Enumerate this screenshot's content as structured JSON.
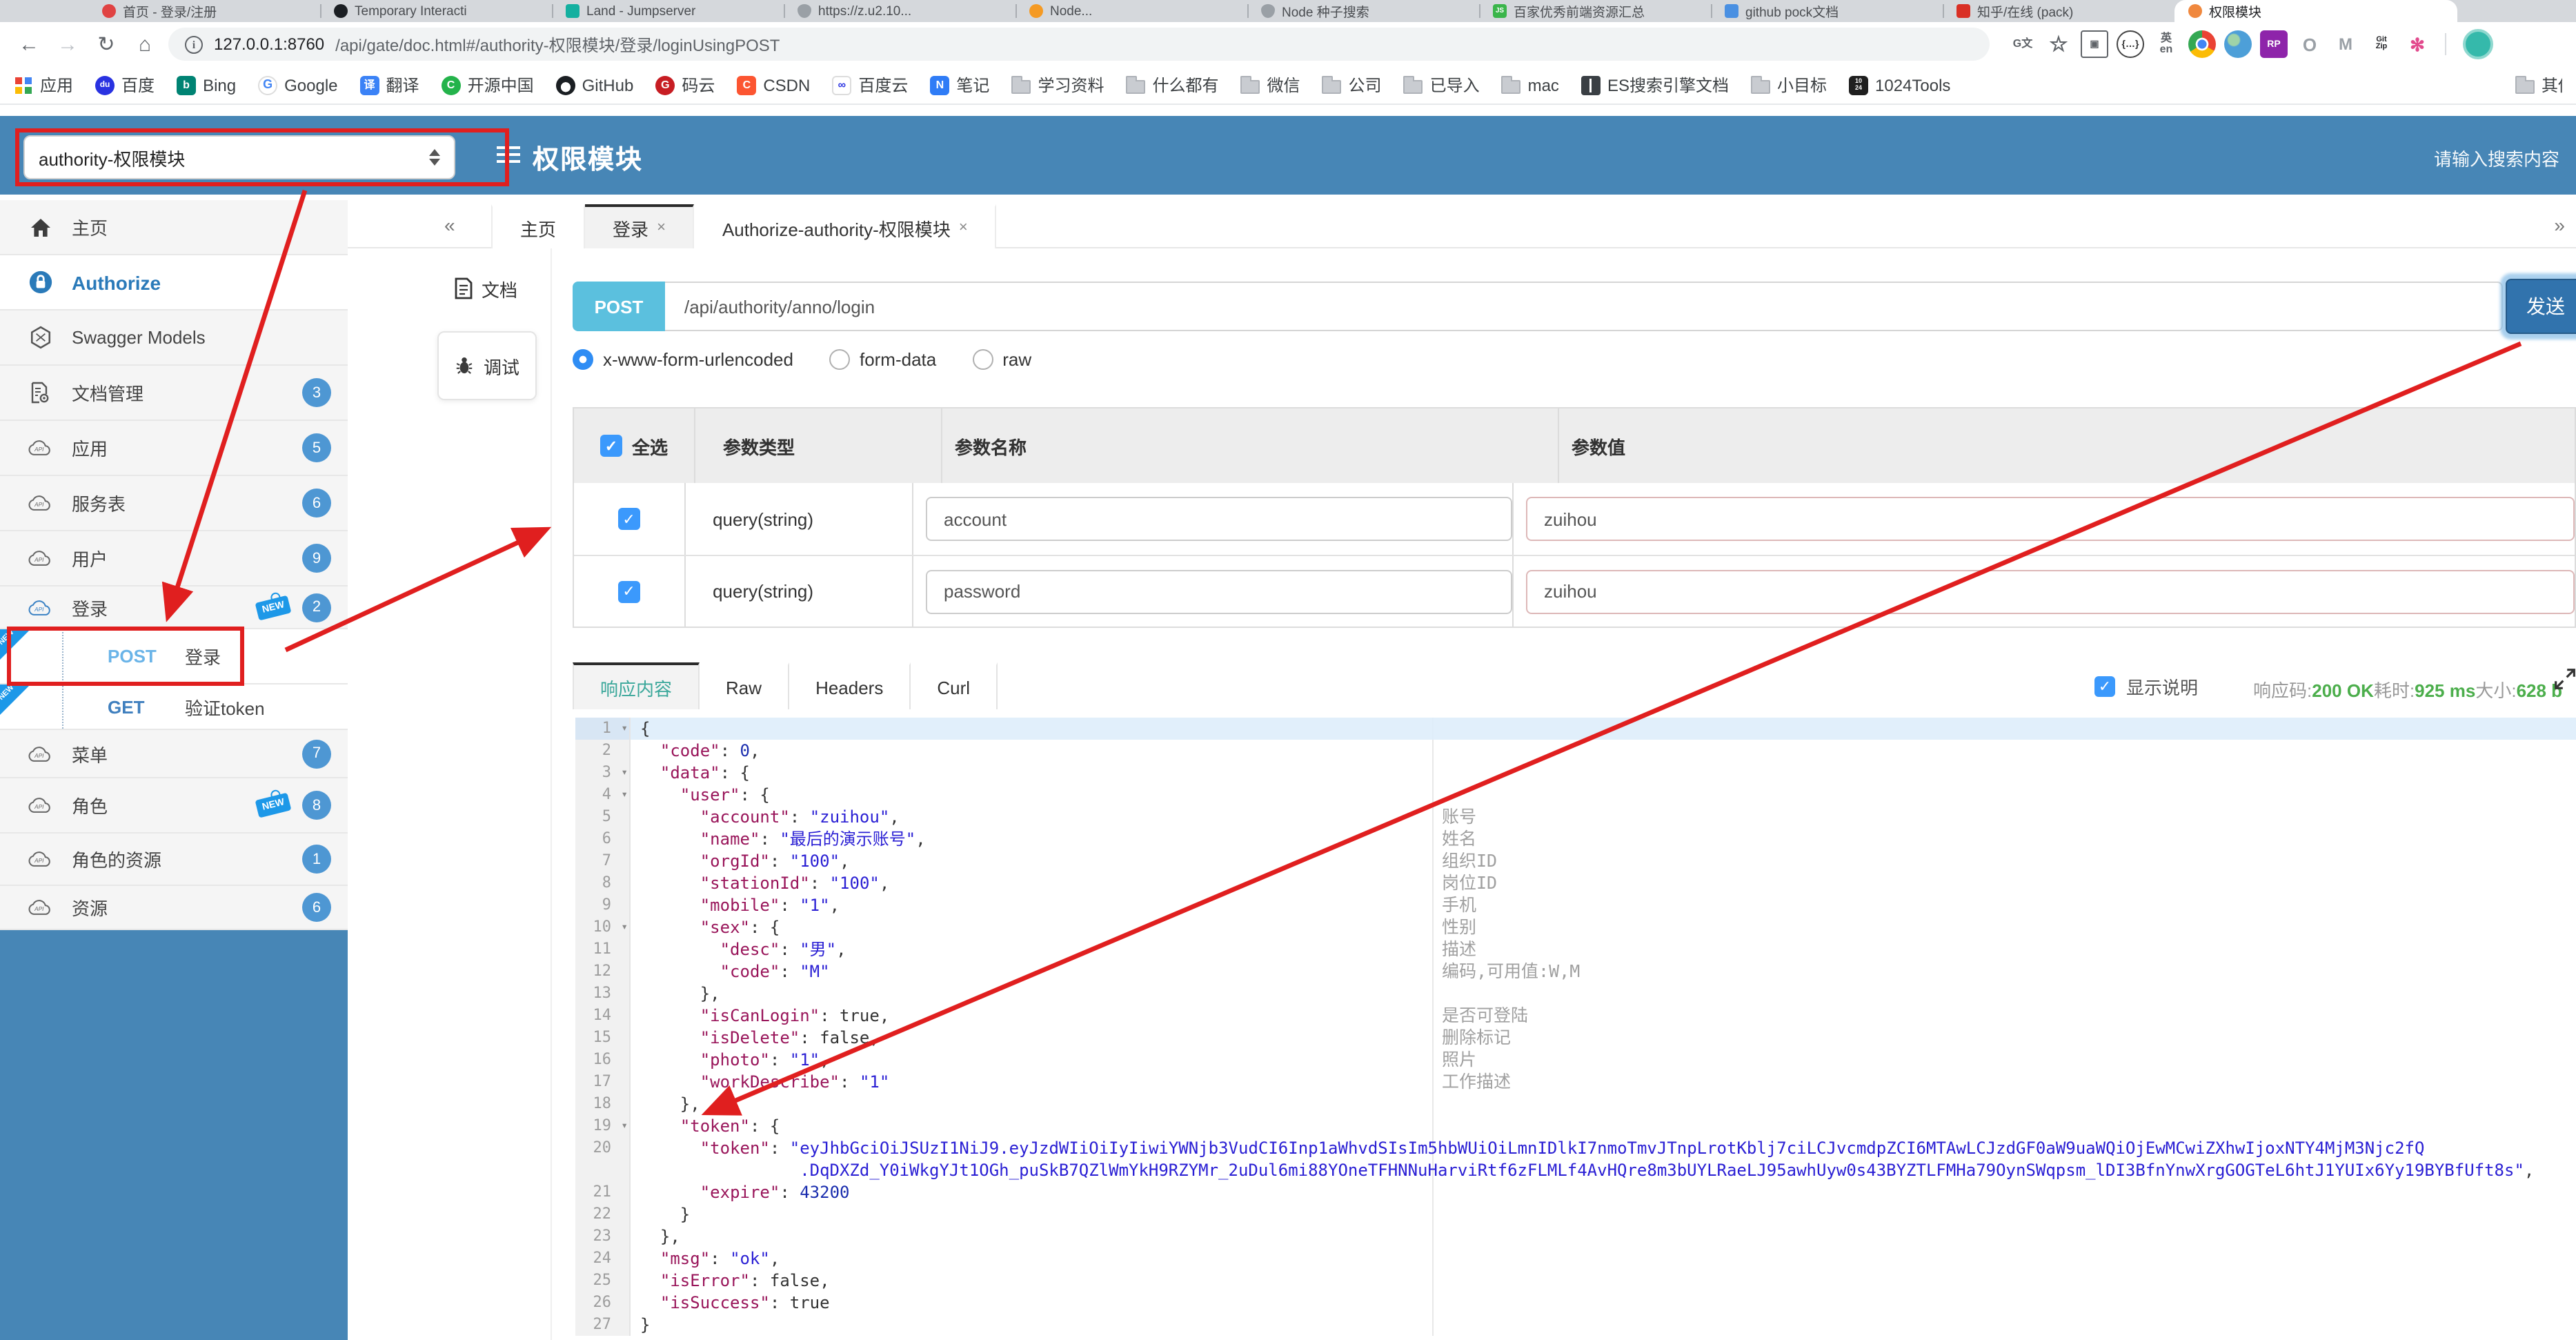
{
  "browser": {
    "tabs": [
      {
        "label": "首页 - 登录/注册",
        "icon": "red-circle",
        "active": false
      },
      {
        "label": "Temporary Interacti",
        "icon": "github",
        "active": false
      },
      {
        "label": "Land - Jumpserver",
        "icon": "teal",
        "active": false
      },
      {
        "label": "https://z.u2.10...",
        "icon": "shield",
        "active": false
      },
      {
        "label": "Node...",
        "icon": "orange",
        "active": false
      },
      {
        "label": "Node 种子搜索",
        "icon": "shield",
        "active": false
      },
      {
        "label": "百家优秀前端资源汇总",
        "icon": "js",
        "active": false
      },
      {
        "label": "github pock文档",
        "icon": "blue",
        "active": false
      },
      {
        "label": "知乎/在线 (pack)",
        "icon": "red-sq",
        "active": false
      },
      {
        "label": "权限模块",
        "icon": "orange-doc",
        "active": true
      }
    ],
    "url": "127.0.0.1:8760/api/gate/doc.html#/authority-权限模块/登录/loginUsingPOST",
    "toolbar_icons": [
      "translate",
      "star",
      "screenshot",
      "json",
      "en-translate",
      "chrome",
      "globe",
      "rp",
      "octotree",
      "mget",
      "gitzip",
      "asterisk"
    ],
    "bookmarks": [
      {
        "label": "应用",
        "icon": "apps"
      },
      {
        "label": "百度",
        "icon": "baidu"
      },
      {
        "label": "Bing",
        "icon": "bing"
      },
      {
        "label": "Google",
        "icon": "google"
      },
      {
        "label": "翻译",
        "icon": "translate"
      },
      {
        "label": "开源中国",
        "icon": "osc"
      },
      {
        "label": "GitHub",
        "icon": "github"
      },
      {
        "label": "码云",
        "icon": "gitee"
      },
      {
        "label": "CSDN",
        "icon": "csdn"
      },
      {
        "label": "百度云",
        "icon": "baidupan"
      },
      {
        "label": "笔记",
        "icon": "note"
      },
      {
        "label": "学习资料",
        "icon": "folder"
      },
      {
        "label": "什么都有",
        "icon": "folder"
      },
      {
        "label": "微信",
        "icon": "folder"
      },
      {
        "label": "公司",
        "icon": "folder"
      },
      {
        "label": "已导入",
        "icon": "folder"
      },
      {
        "label": "mac",
        "icon": "folder"
      },
      {
        "label": "ES搜索引擎文档",
        "icon": "book"
      },
      {
        "label": "小目标",
        "icon": "folder"
      },
      {
        "label": "1024Tools",
        "icon": "tools1024"
      }
    ],
    "bookmarks_other": {
      "label": "其他书签",
      "icon": "folder"
    }
  },
  "header": {
    "module_select": "authority-权限模块",
    "title": "权限模块",
    "search_placeholder": "请输入搜索内容"
  },
  "sidebar": {
    "items": [
      {
        "label": "主页",
        "icon": "home"
      },
      {
        "label": "Authorize",
        "icon": "lock",
        "style": "auth"
      },
      {
        "label": "Swagger Models",
        "icon": "hexagon"
      },
      {
        "label": "文档管理",
        "icon": "doc-gear",
        "badge": "3"
      },
      {
        "label": "应用",
        "icon": "cloud",
        "badge": "5"
      },
      {
        "label": "服务表",
        "icon": "cloud",
        "badge": "6"
      },
      {
        "label": "用户",
        "icon": "cloud",
        "badge": "9"
      },
      {
        "label": "登录",
        "icon": "cloud-blue",
        "badge": "2",
        "new_tag": true
      },
      {
        "label": "登录",
        "method": "POST",
        "new_corner": true,
        "annotated": true
      },
      {
        "label": "验证token",
        "method": "GET",
        "new_corner": true
      },
      {
        "label": "菜单",
        "icon": "cloud",
        "badge": "7"
      },
      {
        "label": "角色",
        "icon": "cloud",
        "badge": "8",
        "new_tag": true
      },
      {
        "label": "角色的资源",
        "icon": "cloud",
        "badge": "1"
      },
      {
        "label": "资源",
        "icon": "cloud",
        "badge": "6"
      }
    ],
    "new_tag_text": "NEW"
  },
  "doc_tabs": {
    "collapse_left": "«",
    "collapse_right": "»",
    "close_glyph": "×",
    "tabs": [
      {
        "label": "主页",
        "closable": false,
        "active": false
      },
      {
        "label": "登录",
        "closable": true,
        "active": true
      },
      {
        "label": "Authorize-authority-权限模块",
        "closable": true,
        "active": false
      }
    ]
  },
  "side_rail": {
    "items": [
      {
        "label": "文档",
        "icon": "doc",
        "active": false
      },
      {
        "label": "调试",
        "icon": "bug",
        "active": true
      }
    ]
  },
  "request": {
    "method": "POST",
    "path": "/api/authority/anno/login",
    "send_label": "发送",
    "body_types": [
      {
        "label": "x-www-form-urlencoded",
        "selected": true
      },
      {
        "label": "form-data",
        "selected": false
      },
      {
        "label": "raw",
        "selected": false
      }
    ]
  },
  "params_table": {
    "headers": {
      "select_all": "全选",
      "type": "参数类型",
      "name": "参数名称",
      "value": "参数值"
    },
    "rows": [
      {
        "checked": true,
        "type": "query(string)",
        "name": "account",
        "value": "zuihou"
      },
      {
        "checked": true,
        "type": "query(string)",
        "name": "password",
        "value": "zuihou"
      }
    ]
  },
  "response": {
    "tabs": [
      {
        "label": "响应内容",
        "active": true
      },
      {
        "label": "Raw",
        "active": false
      },
      {
        "label": "Headers",
        "active": false
      },
      {
        "label": "Curl",
        "active": false
      }
    ],
    "show_desc_label": "显示说明",
    "show_desc_checked": true,
    "status": {
      "code_label": "响应码:",
      "code": "200 OK",
      "time_label": "耗时:",
      "time": "925 ms",
      "size_label": "大小:",
      "size": "628 b"
    }
  },
  "editor": {
    "lines": [
      {
        "n": "1",
        "fold": true,
        "active": true,
        "t": [
          [
            "p",
            "{"
          ]
        ]
      },
      {
        "n": "2",
        "t": [
          [
            "p",
            "  "
          ],
          [
            "k",
            "\"code\""
          ],
          [
            "p",
            ": "
          ],
          [
            "n",
            "0"
          ],
          [
            "p",
            ","
          ]
        ]
      },
      {
        "n": "3",
        "fold": true,
        "t": [
          [
            "p",
            "  "
          ],
          [
            "k",
            "\"data\""
          ],
          [
            "p",
            ": {"
          ]
        ]
      },
      {
        "n": "4",
        "fold": true,
        "t": [
          [
            "p",
            "    "
          ],
          [
            "k",
            "\"user\""
          ],
          [
            "p",
            ": {"
          ]
        ]
      },
      {
        "n": "5",
        "d": "账号",
        "t": [
          [
            "p",
            "      "
          ],
          [
            "k",
            "\"account\""
          ],
          [
            "p",
            ": "
          ],
          [
            "s",
            "\"zuihou\""
          ],
          [
            "p",
            ","
          ]
        ]
      },
      {
        "n": "6",
        "d": "姓名",
        "t": [
          [
            "p",
            "      "
          ],
          [
            "k",
            "\"name\""
          ],
          [
            "p",
            ": "
          ],
          [
            "s",
            "\"最后的演示账号\""
          ],
          [
            "p",
            ","
          ]
        ]
      },
      {
        "n": "7",
        "d": "组织ID",
        "t": [
          [
            "p",
            "      "
          ],
          [
            "k",
            "\"orgId\""
          ],
          [
            "p",
            ": "
          ],
          [
            "s",
            "\"100\""
          ],
          [
            "p",
            ","
          ]
        ]
      },
      {
        "n": "8",
        "d": "岗位ID",
        "t": [
          [
            "p",
            "      "
          ],
          [
            "k",
            "\"stationId\""
          ],
          [
            "p",
            ": "
          ],
          [
            "s",
            "\"100\""
          ],
          [
            "p",
            ","
          ]
        ]
      },
      {
        "n": "9",
        "d": "手机",
        "t": [
          [
            "p",
            "      "
          ],
          [
            "k",
            "\"mobile\""
          ],
          [
            "p",
            ": "
          ],
          [
            "s",
            "\"1\""
          ],
          [
            "p",
            ","
          ]
        ]
      },
      {
        "n": "10",
        "fold": true,
        "d": "性别",
        "t": [
          [
            "p",
            "      "
          ],
          [
            "k",
            "\"sex\""
          ],
          [
            "p",
            ": {"
          ]
        ]
      },
      {
        "n": "11",
        "d": "描述",
        "t": [
          [
            "p",
            "        "
          ],
          [
            "k",
            "\"desc\""
          ],
          [
            "p",
            ": "
          ],
          [
            "s",
            "\"男\""
          ],
          [
            "p",
            ","
          ]
        ]
      },
      {
        "n": "12",
        "d": "编码,可用值:W,M",
        "t": [
          [
            "p",
            "        "
          ],
          [
            "k",
            "\"code\""
          ],
          [
            "p",
            ": "
          ],
          [
            "s",
            "\"M\""
          ]
        ]
      },
      {
        "n": "13",
        "t": [
          [
            "p",
            "      },"
          ]
        ]
      },
      {
        "n": "14",
        "d": "是否可登陆",
        "t": [
          [
            "p",
            "      "
          ],
          [
            "k",
            "\"isCanLogin\""
          ],
          [
            "p",
            ": "
          ],
          [
            "b",
            "true"
          ],
          [
            "p",
            ","
          ]
        ]
      },
      {
        "n": "15",
        "d": "删除标记",
        "t": [
          [
            "p",
            "      "
          ],
          [
            "k",
            "\"isDelete\""
          ],
          [
            "p",
            ": "
          ],
          [
            "b",
            "false"
          ],
          [
            "p",
            ","
          ]
        ]
      },
      {
        "n": "16",
        "d": "照片",
        "t": [
          [
            "p",
            "      "
          ],
          [
            "k",
            "\"photo\""
          ],
          [
            "p",
            ": "
          ],
          [
            "s",
            "\"1\""
          ],
          [
            "p",
            ","
          ]
        ]
      },
      {
        "n": "17",
        "d": "工作描述",
        "t": [
          [
            "p",
            "      "
          ],
          [
            "k",
            "\"workDescribe\""
          ],
          [
            "p",
            ": "
          ],
          [
            "s",
            "\"1\""
          ]
        ]
      },
      {
        "n": "18",
        "t": [
          [
            "p",
            "    },"
          ]
        ]
      },
      {
        "n": "19",
        "fold": true,
        "t": [
          [
            "p",
            "    "
          ],
          [
            "k",
            "\"token\""
          ],
          [
            "p",
            ": {"
          ]
        ]
      },
      {
        "n": "20",
        "t": [
          [
            "p",
            "      "
          ],
          [
            "k",
            "\"token\""
          ],
          [
            "p",
            ": "
          ],
          [
            "s",
            "\"eyJhbGciOiJSUzI1NiJ9.eyJzdWIiOiIyIiwiYWNjb3VudCI6Inp1aWhvdSIsIm5hbWUiOiLmnIDlkI7nmoTmvJTnpLrotKblj7ciLCJvcmdpZCI6MTAwLCJzdGF0aW9uaWQiOjEwMCwiZXhwIjoxNTY4MjM3Njc2fQ"
          ]
        ]
      },
      {
        "n": "",
        "t": [
          [
            "s",
            "                .DqDXZd_Y0iWkgYJt1OGh_puSkB7QZlWmYkH9RZYMr_2uDul6mi88YOneTFHNNuHarviRtf6zFLMLf4AvHQre8m3bUYLRaeLJ95awhUyw0s43BYZTLFMHa79OynSWqpsm_lDI3BfnYnwXrgGOGTeL6htJ1YUIx6Yy19BYBfUft8s\""
          ],
          [
            "p",
            ","
          ]
        ]
      },
      {
        "n": "21",
        "t": [
          [
            "p",
            "      "
          ],
          [
            "k",
            "\"expire\""
          ],
          [
            "p",
            ": "
          ],
          [
            "n",
            "43200"
          ]
        ]
      },
      {
        "n": "22",
        "t": [
          [
            "p",
            "    }"
          ]
        ]
      },
      {
        "n": "23",
        "t": [
          [
            "p",
            "  },"
          ]
        ]
      },
      {
        "n": "24",
        "t": [
          [
            "p",
            "  "
          ],
          [
            "k",
            "\"msg\""
          ],
          [
            "p",
            ": "
          ],
          [
            "s",
            "\"ok\""
          ],
          [
            "p",
            ","
          ]
        ]
      },
      {
        "n": "25",
        "t": [
          [
            "p",
            "  "
          ],
          [
            "k",
            "\"isError\""
          ],
          [
            "p",
            ": "
          ],
          [
            "b",
            "false"
          ],
          [
            "p",
            ","
          ]
        ]
      },
      {
        "n": "26",
        "t": [
          [
            "p",
            "  "
          ],
          [
            "k",
            "\"isSuccess\""
          ],
          [
            "p",
            ": "
          ],
          [
            "b",
            "true"
          ]
        ]
      },
      {
        "n": "27",
        "t": [
          [
            "p",
            "}"
          ]
        ]
      }
    ]
  },
  "colors": {
    "header_blue": "#4786b6",
    "badge_blue": "#4e97d3",
    "method_post": "#5bc0de",
    "send_button": "#3173ad",
    "success_green": "#4cae4c",
    "active_tab_teal": "#3aa79a",
    "annotation_red": "#e01f1f",
    "json_key": "#99155a",
    "json_string": "#2a1fd4",
    "json_number": "#1a2dae"
  }
}
